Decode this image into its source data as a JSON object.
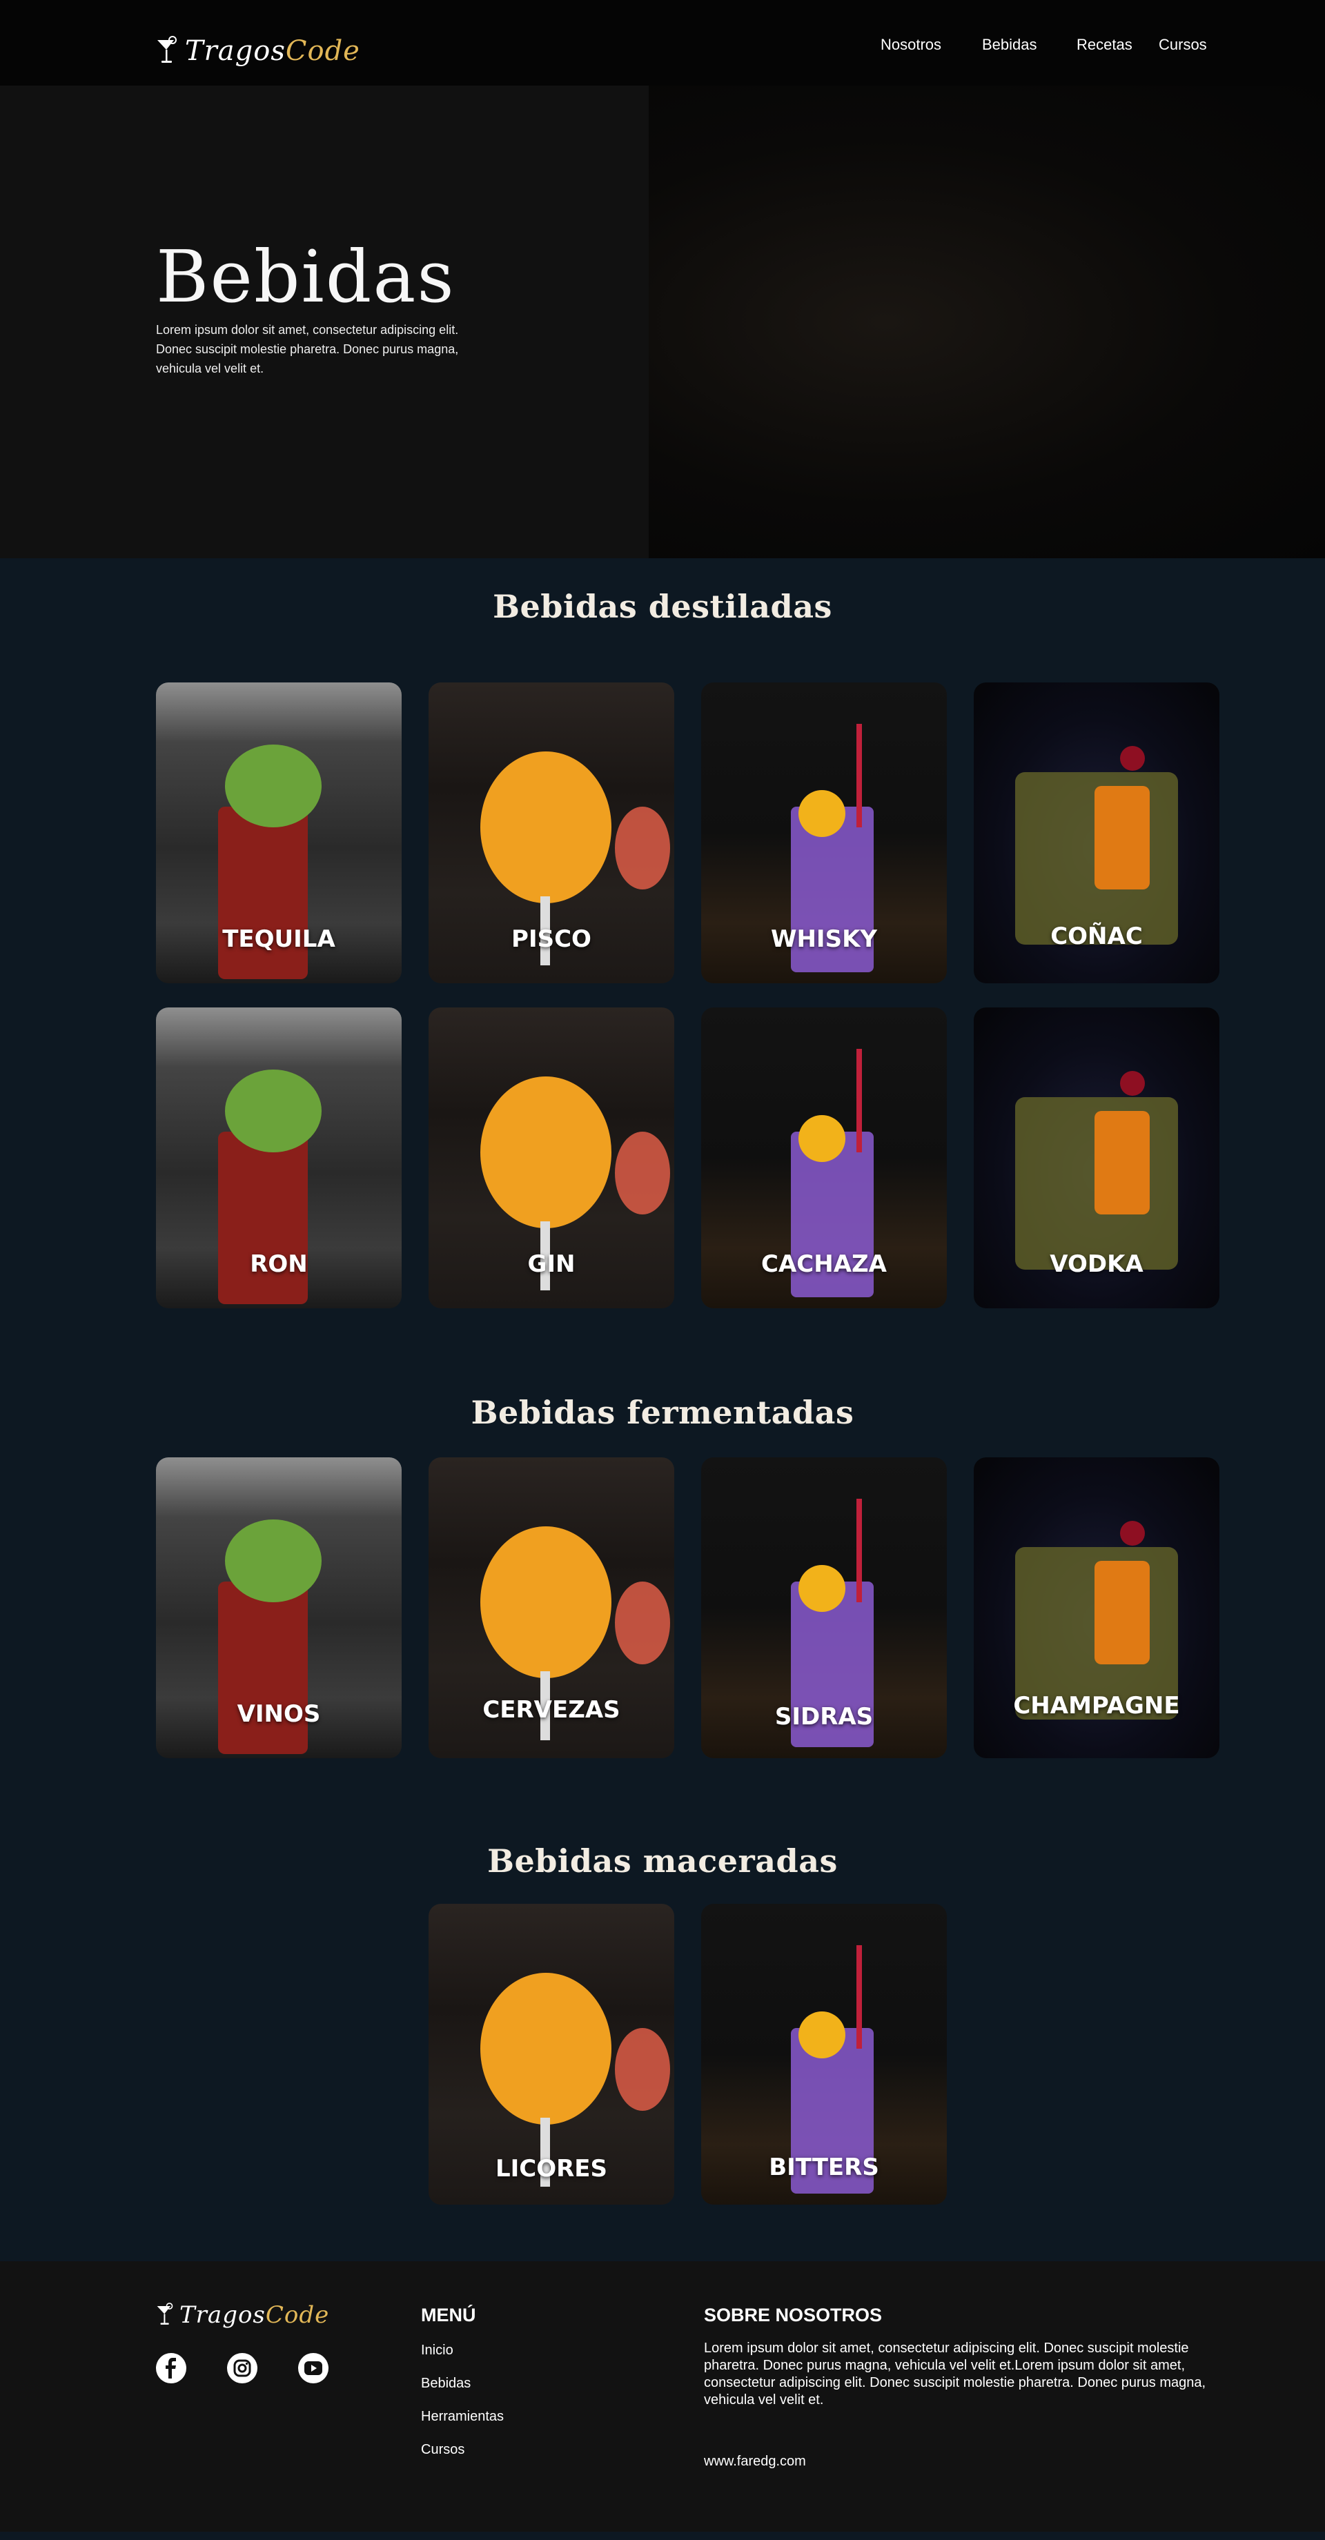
{
  "brand": {
    "name_part1": "Tragos",
    "name_part2": "Code",
    "accent_color": "#e2b757"
  },
  "nav": {
    "items": [
      "Nosotros",
      "Bebidas",
      "Recetas",
      "Cursos"
    ]
  },
  "hero": {
    "title": "Bebidas",
    "description": "Lorem ipsum dolor sit amet, consectetur adipiscing elit. Donec suscipit molestie pharetra. Donec purus magna, vehicula vel velit et."
  },
  "sections": {
    "destiladas": {
      "title": "Bebidas destiladas",
      "items": [
        "TEQUILA",
        "PISCO",
        "WHISKY",
        "COÑAC",
        "RON",
        "GIN",
        "CACHAZA",
        "VODKA"
      ]
    },
    "fermentadas": {
      "title": "Bebidas fermentadas",
      "items": [
        "VINOS",
        "CERVEZAS",
        "SIDRAS",
        "CHAMPAGNE"
      ]
    },
    "maceradas": {
      "title": "Bebidas maceradas",
      "items": [
        "LICORES",
        "BITTERS"
      ]
    }
  },
  "footer": {
    "menu_heading": "MENÚ",
    "menu_items": [
      "Inicio",
      "Bebidas",
      "Herramientas",
      "Cursos"
    ],
    "about_heading": "SOBRE NOSOTROS",
    "about_text": "Lorem ipsum dolor sit amet, consectetur adipiscing elit. Donec suscipit molestie pharetra. Donec purus magna, vehicula vel velit et.Lorem ipsum dolor sit amet, consectetur adipiscing elit. Donec suscipit molestie pharetra. Donec purus magna, vehicula vel velit et.",
    "url": "www.faredg.com",
    "social_icons": [
      "facebook-icon",
      "instagram-icon",
      "youtube-icon"
    ]
  },
  "colors": {
    "background": "#0d1822",
    "header": "#050505",
    "footer": "#121212"
  }
}
